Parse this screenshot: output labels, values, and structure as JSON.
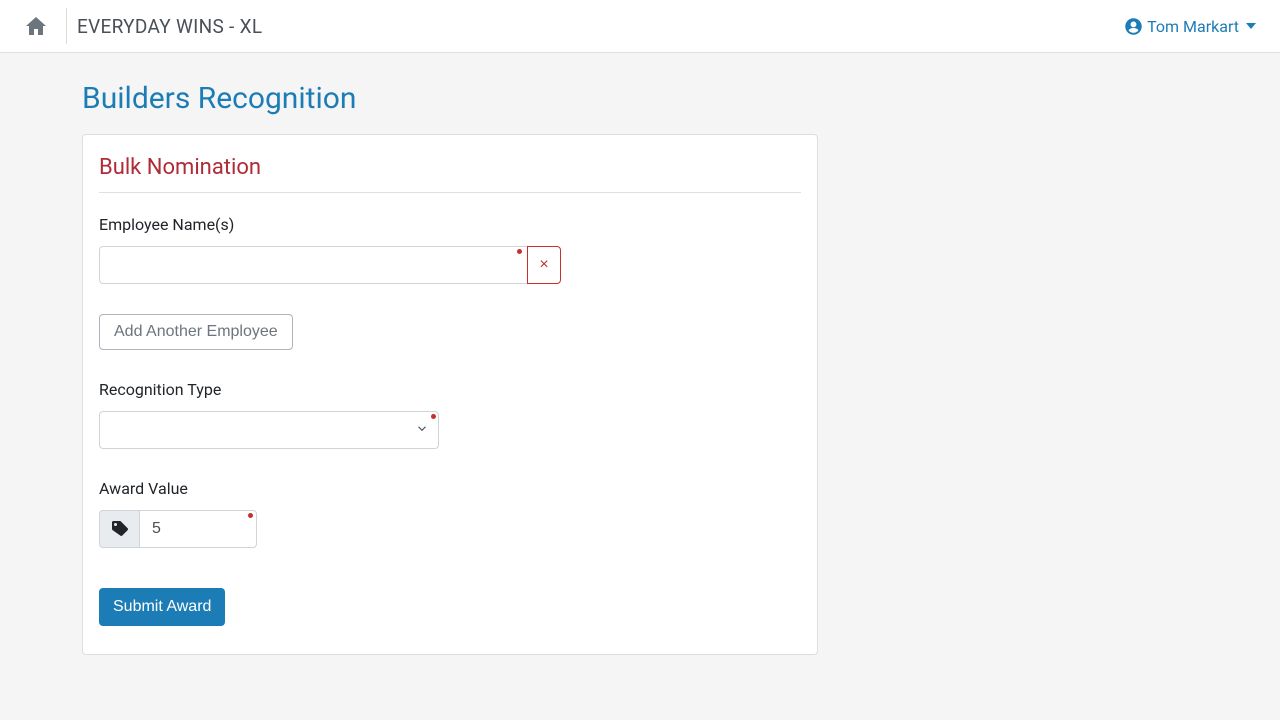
{
  "header": {
    "brand": "EVERYDAY WINS - XL",
    "user_name": "Tom Markart"
  },
  "page": {
    "title": "Builders Recognition"
  },
  "card": {
    "title": "Bulk Nomination"
  },
  "form": {
    "employee_label": "Employee Name(s)",
    "employee_value": "",
    "remove_symbol": "×",
    "add_employee_label": "Add Another Employee",
    "recognition_type_label": "Recognition Type",
    "recognition_type_value": "",
    "award_value_label": "Award Value",
    "award_value": "5",
    "submit_label": "Submit Award"
  }
}
